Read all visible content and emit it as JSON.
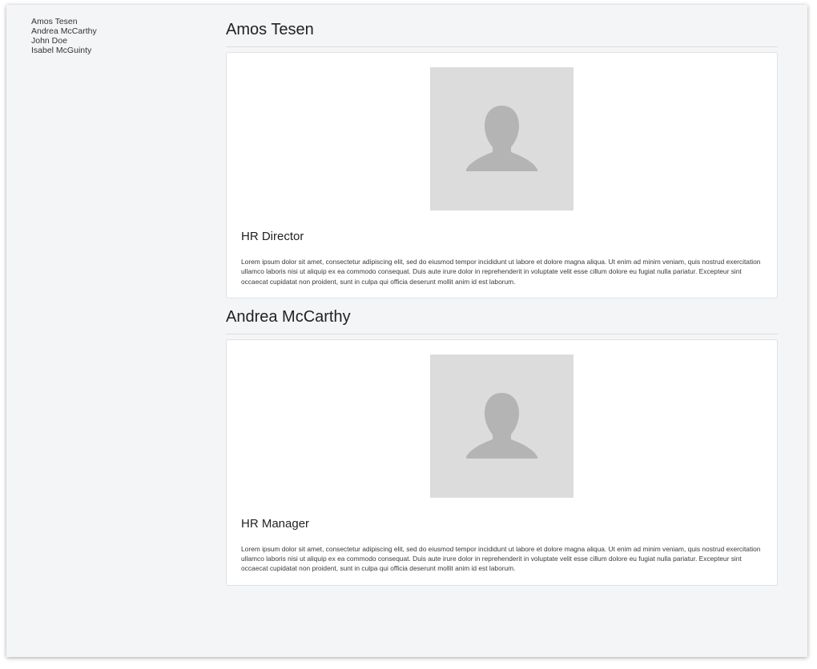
{
  "sidebar": {
    "links": [
      "Amos Tesen",
      "Andrea McCarthy",
      "John Doe",
      "Isabel McGuinty"
    ]
  },
  "profiles": [
    {
      "name": "Amos Tesen",
      "role": "HR Director",
      "bio": "Lorem ipsum dolor sit amet, consectetur adipiscing elit, sed do eiusmod tempor incididunt ut labore et dolore magna aliqua. Ut enim ad minim veniam, quis nostrud exercitation ullamco laboris nisi ut aliquip ex ea commodo consequat. Duis aute irure dolor in reprehenderit in voluptate velit esse cillum dolore eu fugiat nulla pariatur. Excepteur sint occaecat cupidatat non proident, sunt in culpa qui officia deserunt mollit anim id est laborum.",
      "avatar_icon": "user-placeholder-icon"
    },
    {
      "name": "Andrea McCarthy",
      "role": "HR Manager",
      "bio": "Lorem ipsum dolor sit amet, consectetur adipiscing elit, sed do eiusmod tempor incididunt ut labore et dolore magna aliqua. Ut enim ad minim veniam, quis nostrud exercitation ullamco laboris nisi ut aliquip ex ea commodo consequat. Duis aute irure dolor in reprehenderit in voluptate velit esse cillum dolore eu fugiat nulla pariatur. Excepteur sint occaecat cupidatat non proident, sunt in culpa qui officia deserunt mollit anim id est laborum.",
      "avatar_icon": "user-placeholder-icon"
    }
  ],
  "colors": {
    "page_background": "#f4f5f7",
    "card_background": "#ffffff",
    "avatar_background": "#dcdcdc",
    "avatar_silhouette": "#b4b4b4"
  }
}
